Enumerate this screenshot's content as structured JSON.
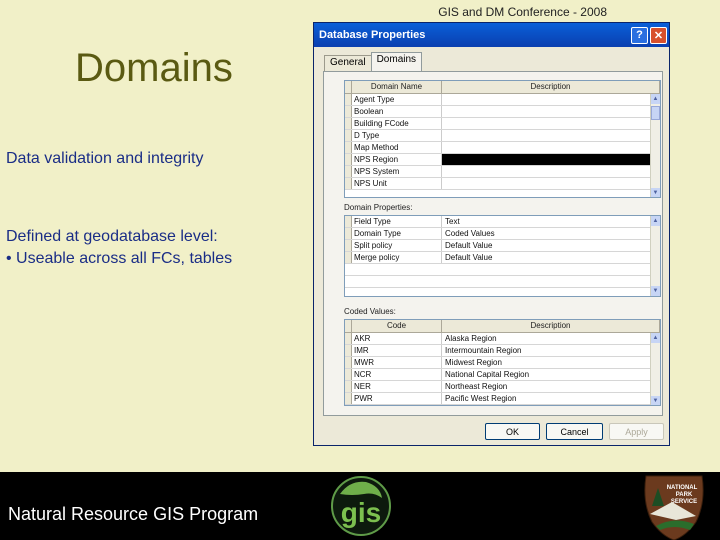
{
  "header": {
    "conference": "GIS and DM Conference - 2008"
  },
  "slide": {
    "title": "Domains",
    "bullet1": "Data validation and integrity",
    "bullet2_line1": "Defined at geodatabase level:",
    "bullet2_line2": "• Useable across all FCs, tables"
  },
  "footer": {
    "program": "Natural Resource GIS Program"
  },
  "logos": {
    "gis_text": "gis",
    "nps_line1": "NATIONAL",
    "nps_line2": "PARK",
    "nps_line3": "SERVICE"
  },
  "dialog": {
    "title": "Database Properties",
    "help": "?",
    "close": "✕",
    "tabs": [
      "General",
      "Domains"
    ],
    "active_tab": "Domains",
    "domains_grid": {
      "headers": [
        "Domain Name",
        "Description"
      ],
      "rows": [
        {
          "name": "Agent Type",
          "description": ""
        },
        {
          "name": "Boolean",
          "description": ""
        },
        {
          "name": "Building FCode",
          "description": ""
        },
        {
          "name": "D Type",
          "description": ""
        },
        {
          "name": "Map Method",
          "description": ""
        },
        {
          "name": "NPS Region",
          "description": "",
          "selected": true
        },
        {
          "name": "NPS System",
          "description": ""
        },
        {
          "name": "NPS Unit",
          "description": ""
        }
      ]
    },
    "properties_label": "Domain Properties:",
    "properties_grid": {
      "rows": [
        {
          "name": "Field Type",
          "value": "Text"
        },
        {
          "name": "Domain Type",
          "value": "Coded Values"
        },
        {
          "name": "Split policy",
          "value": "Default Value"
        },
        {
          "name": "Merge policy",
          "value": "Default Value"
        }
      ]
    },
    "coded_label": "Coded Values:",
    "coded_grid": {
      "headers": [
        "Code",
        "Description"
      ],
      "rows": [
        {
          "code": "AKR",
          "description": "Alaska Region"
        },
        {
          "code": "IMR",
          "description": "Intermountain Region"
        },
        {
          "code": "MWR",
          "description": "Midwest Region"
        },
        {
          "code": "NCR",
          "description": "National Capital Region"
        },
        {
          "code": "NER",
          "description": "Northeast Region"
        },
        {
          "code": "PWR",
          "description": "Pacific West Region"
        }
      ]
    },
    "buttons": {
      "ok": "OK",
      "cancel": "Cancel",
      "apply": "Apply"
    }
  }
}
